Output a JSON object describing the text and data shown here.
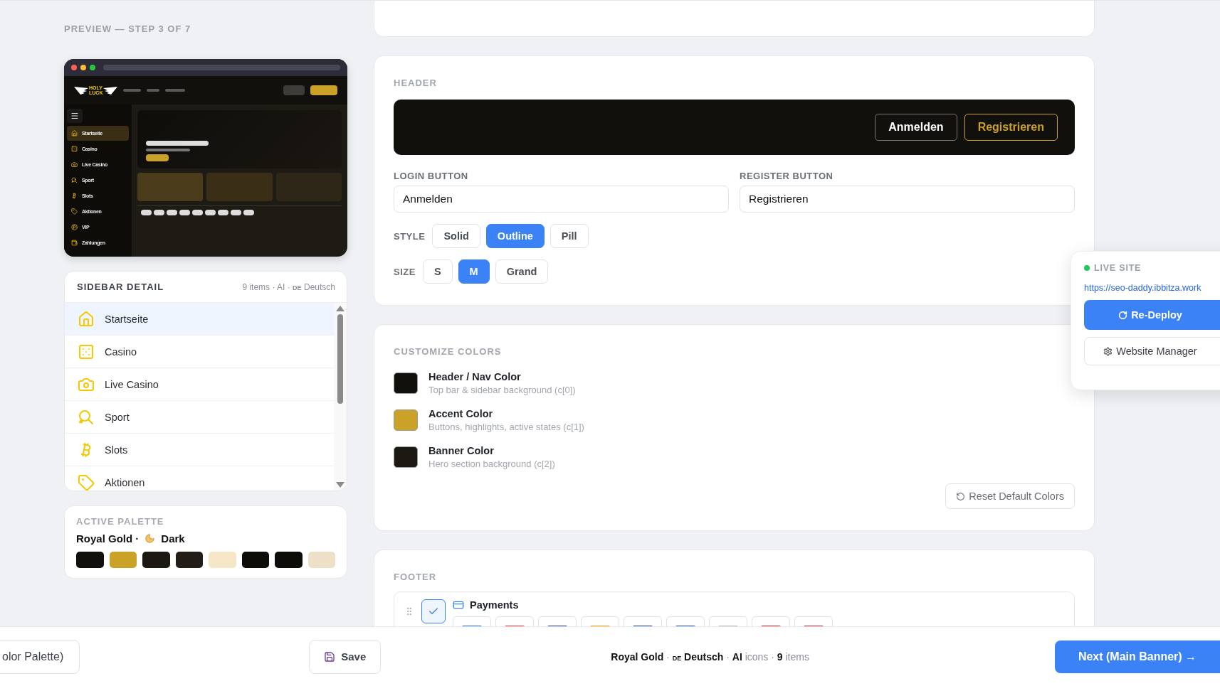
{
  "preview": {
    "step_label": "PREVIEW — STEP 3 OF 7",
    "logo": [
      "HOLY",
      "LUCK"
    ],
    "sidebar_items": [
      {
        "label": "Startseite",
        "selected": true
      },
      {
        "label": "Casino",
        "selected": false
      },
      {
        "label": "Live Casino",
        "selected": false
      },
      {
        "label": "Sport",
        "selected": false
      },
      {
        "label": "Slots",
        "selected": false
      },
      {
        "label": "Aktionen",
        "selected": false
      },
      {
        "label": "VIP",
        "selected": false
      },
      {
        "label": "Zahlungen",
        "selected": false
      }
    ]
  },
  "sidebar_detail": {
    "title": "SIDEBAR DETAIL",
    "meta": "9 items · AI ·",
    "flag": "DE",
    "language": "Deutsch",
    "items": [
      {
        "label": "Startseite",
        "selected": true
      },
      {
        "label": "Casino",
        "selected": false
      },
      {
        "label": "Live Casino",
        "selected": false
      },
      {
        "label": "Sport",
        "selected": false
      },
      {
        "label": "Slots",
        "selected": false
      },
      {
        "label": "Aktionen",
        "selected": false
      }
    ]
  },
  "active_palette": {
    "title": "ACTIVE PALETTE",
    "name": "Royal Gold ·",
    "mode": "Dark",
    "swatches": [
      {
        "color": "#12100c"
      },
      {
        "color": "#c9a227"
      },
      {
        "color": "#1c1812"
      },
      {
        "color": "#221d16"
      },
      {
        "color": "#f5e6c8"
      },
      {
        "color": "#0e0c09"
      },
      {
        "color": "#0e0c09"
      },
      {
        "color": "#ede0c6"
      }
    ]
  },
  "header": {
    "title": "HEADER",
    "preview_login": "Anmelden",
    "preview_register": "Registrieren",
    "login_field": {
      "label": "LOGIN BUTTON",
      "value": "Anmelden"
    },
    "register_field": {
      "label": "REGISTER BUTTON",
      "value": "Registrieren"
    },
    "style_label": "STYLE",
    "style_options": [
      {
        "label": "Solid",
        "selected": false
      },
      {
        "label": "Outline",
        "selected": true
      },
      {
        "label": "Pill",
        "selected": false
      }
    ],
    "size_label": "SIZE",
    "size_options": [
      {
        "label": "S",
        "selected": false
      },
      {
        "label": "M",
        "selected": true
      },
      {
        "label": "Grand",
        "selected": false
      }
    ]
  },
  "customize_colors": {
    "title": "CUSTOMIZE COLORS",
    "items": [
      {
        "name": "Header / Nav Color",
        "description": "Top bar & sidebar background (c[0])",
        "color": "#12100c"
      },
      {
        "name": "Accent Color",
        "description": "Buttons, highlights, active states (c[1])",
        "color": "#c9a227"
      },
      {
        "name": "Banner Color",
        "description": "Hero section background (c[2])",
        "color": "#1c1812"
      }
    ],
    "reset_button": "Reset Default Colors"
  },
  "footer": {
    "title": "FOOTER",
    "items": [
      {
        "label": "Payments",
        "checked": true
      }
    ]
  },
  "live_site": {
    "title": "LIVE SITE",
    "url": "https://seo-daddy.ibbitza.work",
    "redeploy_button": "Re-Deploy",
    "manager_button": "Website Manager"
  },
  "bottom_bar": {
    "back_button": "olor Palette)",
    "save_button": "Save",
    "summary": [
      {
        "text": "Royal Gold",
        "kind": "strong"
      },
      {
        "text": " · ",
        "kind": "muted"
      },
      {
        "text": "DE",
        "kind": "flag"
      },
      {
        "text": " Deutsch",
        "kind": "strong"
      },
      {
        "text": " · ",
        "kind": "muted"
      },
      {
        "text": "AI",
        "kind": "strong"
      },
      {
        "text": " icons · ",
        "kind": "muted"
      },
      {
        "text": "9",
        "kind": "strong"
      },
      {
        "text": " items",
        "kind": "muted"
      }
    ],
    "next_button": "Next (Main Banner) →"
  }
}
